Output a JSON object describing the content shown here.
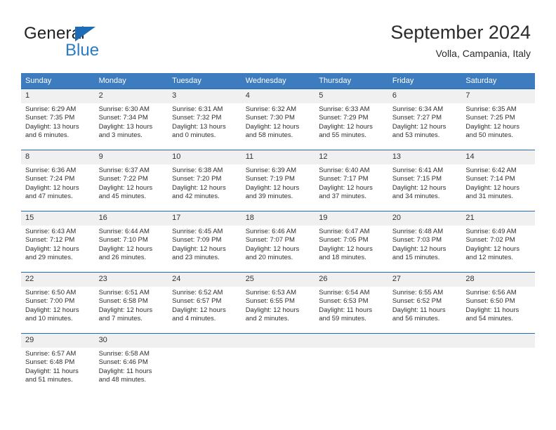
{
  "brand": {
    "name_top": "General",
    "name_bottom": "Blue",
    "accent_color": "#2b7cc4",
    "triangle_color": "#1d6cb5"
  },
  "header": {
    "title": "September 2024",
    "subtitle": "Volla, Campania, Italy"
  },
  "theme": {
    "header_bg": "#3d7cbf",
    "header_text": "#ffffff",
    "daynum_bg": "#f0f0f0",
    "cell_border": "#1d6cb5"
  },
  "weekdays": [
    "Sunday",
    "Monday",
    "Tuesday",
    "Wednesday",
    "Thursday",
    "Friday",
    "Saturday"
  ],
  "labels": {
    "sunrise_prefix": "Sunrise:",
    "sunset_prefix": "Sunset:",
    "daylight_prefix": "Daylight:"
  },
  "weeks": [
    [
      {
        "day": "1",
        "sunrise": "Sunrise: 6:29 AM",
        "sunset": "Sunset: 7:35 PM",
        "daylight": "Daylight: 13 hours and 6 minutes."
      },
      {
        "day": "2",
        "sunrise": "Sunrise: 6:30 AM",
        "sunset": "Sunset: 7:34 PM",
        "daylight": "Daylight: 13 hours and 3 minutes."
      },
      {
        "day": "3",
        "sunrise": "Sunrise: 6:31 AM",
        "sunset": "Sunset: 7:32 PM",
        "daylight": "Daylight: 13 hours and 0 minutes."
      },
      {
        "day": "4",
        "sunrise": "Sunrise: 6:32 AM",
        "sunset": "Sunset: 7:30 PM",
        "daylight": "Daylight: 12 hours and 58 minutes."
      },
      {
        "day": "5",
        "sunrise": "Sunrise: 6:33 AM",
        "sunset": "Sunset: 7:29 PM",
        "daylight": "Daylight: 12 hours and 55 minutes."
      },
      {
        "day": "6",
        "sunrise": "Sunrise: 6:34 AM",
        "sunset": "Sunset: 7:27 PM",
        "daylight": "Daylight: 12 hours and 53 minutes."
      },
      {
        "day": "7",
        "sunrise": "Sunrise: 6:35 AM",
        "sunset": "Sunset: 7:25 PM",
        "daylight": "Daylight: 12 hours and 50 minutes."
      }
    ],
    [
      {
        "day": "8",
        "sunrise": "Sunrise: 6:36 AM",
        "sunset": "Sunset: 7:24 PM",
        "daylight": "Daylight: 12 hours and 47 minutes."
      },
      {
        "day": "9",
        "sunrise": "Sunrise: 6:37 AM",
        "sunset": "Sunset: 7:22 PM",
        "daylight": "Daylight: 12 hours and 45 minutes."
      },
      {
        "day": "10",
        "sunrise": "Sunrise: 6:38 AM",
        "sunset": "Sunset: 7:20 PM",
        "daylight": "Daylight: 12 hours and 42 minutes."
      },
      {
        "day": "11",
        "sunrise": "Sunrise: 6:39 AM",
        "sunset": "Sunset: 7:19 PM",
        "daylight": "Daylight: 12 hours and 39 minutes."
      },
      {
        "day": "12",
        "sunrise": "Sunrise: 6:40 AM",
        "sunset": "Sunset: 7:17 PM",
        "daylight": "Daylight: 12 hours and 37 minutes."
      },
      {
        "day": "13",
        "sunrise": "Sunrise: 6:41 AM",
        "sunset": "Sunset: 7:15 PM",
        "daylight": "Daylight: 12 hours and 34 minutes."
      },
      {
        "day": "14",
        "sunrise": "Sunrise: 6:42 AM",
        "sunset": "Sunset: 7:14 PM",
        "daylight": "Daylight: 12 hours and 31 minutes."
      }
    ],
    [
      {
        "day": "15",
        "sunrise": "Sunrise: 6:43 AM",
        "sunset": "Sunset: 7:12 PM",
        "daylight": "Daylight: 12 hours and 29 minutes."
      },
      {
        "day": "16",
        "sunrise": "Sunrise: 6:44 AM",
        "sunset": "Sunset: 7:10 PM",
        "daylight": "Daylight: 12 hours and 26 minutes."
      },
      {
        "day": "17",
        "sunrise": "Sunrise: 6:45 AM",
        "sunset": "Sunset: 7:09 PM",
        "daylight": "Daylight: 12 hours and 23 minutes."
      },
      {
        "day": "18",
        "sunrise": "Sunrise: 6:46 AM",
        "sunset": "Sunset: 7:07 PM",
        "daylight": "Daylight: 12 hours and 20 minutes."
      },
      {
        "day": "19",
        "sunrise": "Sunrise: 6:47 AM",
        "sunset": "Sunset: 7:05 PM",
        "daylight": "Daylight: 12 hours and 18 minutes."
      },
      {
        "day": "20",
        "sunrise": "Sunrise: 6:48 AM",
        "sunset": "Sunset: 7:03 PM",
        "daylight": "Daylight: 12 hours and 15 minutes."
      },
      {
        "day": "21",
        "sunrise": "Sunrise: 6:49 AM",
        "sunset": "Sunset: 7:02 PM",
        "daylight": "Daylight: 12 hours and 12 minutes."
      }
    ],
    [
      {
        "day": "22",
        "sunrise": "Sunrise: 6:50 AM",
        "sunset": "Sunset: 7:00 PM",
        "daylight": "Daylight: 12 hours and 10 minutes."
      },
      {
        "day": "23",
        "sunrise": "Sunrise: 6:51 AM",
        "sunset": "Sunset: 6:58 PM",
        "daylight": "Daylight: 12 hours and 7 minutes."
      },
      {
        "day": "24",
        "sunrise": "Sunrise: 6:52 AM",
        "sunset": "Sunset: 6:57 PM",
        "daylight": "Daylight: 12 hours and 4 minutes."
      },
      {
        "day": "25",
        "sunrise": "Sunrise: 6:53 AM",
        "sunset": "Sunset: 6:55 PM",
        "daylight": "Daylight: 12 hours and 2 minutes."
      },
      {
        "day": "26",
        "sunrise": "Sunrise: 6:54 AM",
        "sunset": "Sunset: 6:53 PM",
        "daylight": "Daylight: 11 hours and 59 minutes."
      },
      {
        "day": "27",
        "sunrise": "Sunrise: 6:55 AM",
        "sunset": "Sunset: 6:52 PM",
        "daylight": "Daylight: 11 hours and 56 minutes."
      },
      {
        "day": "28",
        "sunrise": "Sunrise: 6:56 AM",
        "sunset": "Sunset: 6:50 PM",
        "daylight": "Daylight: 11 hours and 54 minutes."
      }
    ],
    [
      {
        "day": "29",
        "sunrise": "Sunrise: 6:57 AM",
        "sunset": "Sunset: 6:48 PM",
        "daylight": "Daylight: 11 hours and 51 minutes."
      },
      {
        "day": "30",
        "sunrise": "Sunrise: 6:58 AM",
        "sunset": "Sunset: 6:46 PM",
        "daylight": "Daylight: 11 hours and 48 minutes."
      },
      {
        "day": "",
        "sunrise": "",
        "sunset": "",
        "daylight": ""
      },
      {
        "day": "",
        "sunrise": "",
        "sunset": "",
        "daylight": ""
      },
      {
        "day": "",
        "sunrise": "",
        "sunset": "",
        "daylight": ""
      },
      {
        "day": "",
        "sunrise": "",
        "sunset": "",
        "daylight": ""
      },
      {
        "day": "",
        "sunrise": "",
        "sunset": "",
        "daylight": ""
      }
    ]
  ]
}
